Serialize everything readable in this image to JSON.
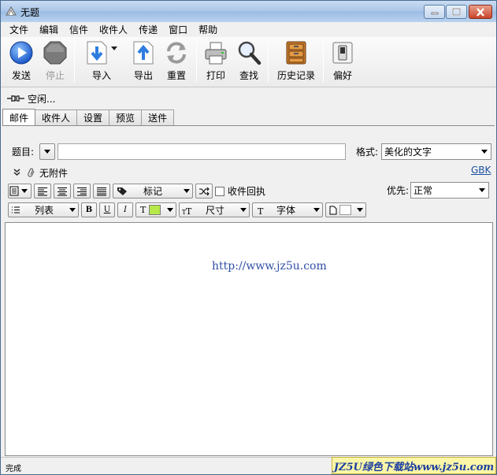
{
  "window": {
    "title": "无题"
  },
  "menu": [
    "文件",
    "编辑",
    "信件",
    "收件人",
    "传递",
    "窗口",
    "帮助"
  ],
  "toolbar": {
    "send": "发送",
    "stop": "停止",
    "import": "导入",
    "export": "导出",
    "reset": "重置",
    "print": "打印",
    "find": "查找",
    "history": "历史记录",
    "prefs": "偏好"
  },
  "connection_status": "空闲...",
  "tabs": [
    "邮件",
    "收件人",
    "设置",
    "预览",
    "送件"
  ],
  "compose": {
    "subject_label": "题目:",
    "subject_value": "",
    "format_label": "格式:",
    "format_value": "美化的文字",
    "encoding_link": "GBK",
    "attachments": "无附件",
    "mark_label": "标记",
    "receipt_label": "收件回执",
    "priority_label": "优先:",
    "priority_value": "正常",
    "list_label": "列表",
    "bold": "B",
    "underline": "U",
    "italic": "I",
    "color_t": "T",
    "size_label": "尺寸",
    "font_label": "字体",
    "body_text": "http://www.jz5u.com"
  },
  "status_bar": {
    "text": "完成"
  },
  "watermark": "JZ5U绿色下载站www.jz5u.com",
  "colors": {
    "text_color_swatch": "#b6e84a",
    "url_color": "#2f4fa3"
  }
}
